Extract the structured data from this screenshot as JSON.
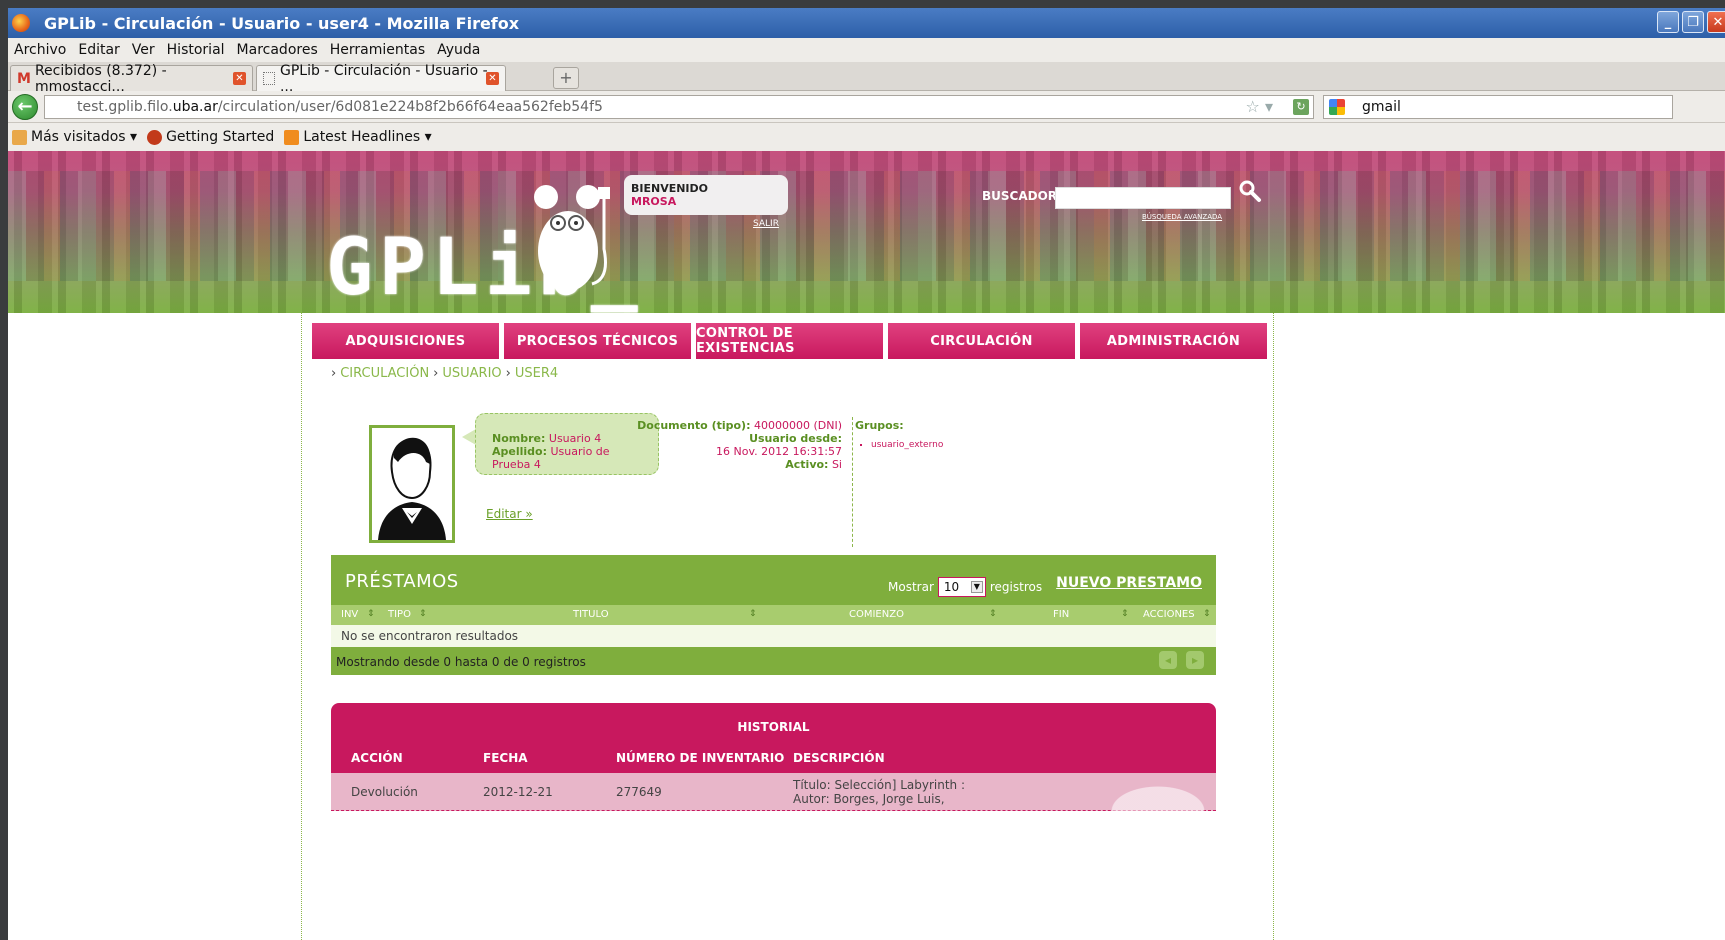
{
  "window": {
    "title": "GPLib - Circulación - Usuario - user4 - Mozilla Firefox"
  },
  "menu": [
    "Archivo",
    "Editar",
    "Ver",
    "Historial",
    "Marcadores",
    "Herramientas",
    "Ayuda"
  ],
  "tabs": [
    {
      "label": "Recibidos (8.372) - mmostacci...",
      "active": false
    },
    {
      "label": "GPLib - Circulación - Usuario - ...",
      "active": true
    }
  ],
  "nav": {
    "url_prefix": "test.gplib.filo.",
    "url_domain": "uba.ar",
    "url_path": "/circulation/user/6d081e224b8f2b66f64eaa562feb54f5",
    "search_value": "gmail"
  },
  "bookmarks": [
    "Más visitados",
    "Getting Started",
    "Latest Headlines"
  ],
  "header": {
    "logo": "GPLib_",
    "welcome_label": "BIENVENIDO",
    "welcome_user": "MROSA",
    "logout": "SALIR",
    "search_label": "BUSCADOR",
    "advanced_search": "BÚSQUEDA AVANZADA"
  },
  "main_nav": [
    "ADQUISICIONES",
    "PROCESOS TÉCNICOS",
    "CONTROL DE EXISTENCIAS",
    "CIRCULACIÓN",
    "ADMINISTRACIÓN"
  ],
  "breadcrumb": [
    "CIRCULACIÓN",
    "USUARIO",
    "USER4"
  ],
  "user": {
    "nombre_label": "Nombre:",
    "nombre": "Usuario 4",
    "apellido_label": "Apellido:",
    "apellido": "Usuario de Prueba 4",
    "edit_link": "Editar »",
    "documento_label": "Documento (tipo):",
    "documento": "40000000 (DNI)",
    "desde_label": "Usuario desde:",
    "desde": "16 Nov. 2012 16:31:57",
    "activo_label": "Activo:",
    "activo": "Si",
    "grupos_label": "Grupos:",
    "grupos": [
      "usuario_externo"
    ]
  },
  "prestamos": {
    "title": "PRÉSTAMOS",
    "mostrar_label": "Mostrar",
    "mostrar_value": "10",
    "registros_label": "registros",
    "new_button": "NUEVO PRESTAMO",
    "columns": [
      "INV",
      "TIPO",
      "TITULO",
      "COMIENZO",
      "FIN",
      "ACCIONES"
    ],
    "empty_message": "No se encontraron resultados",
    "info": "Mostrando desde 0 hasta 0 de 0 registros"
  },
  "historial": {
    "title": "HISTORIAL",
    "columns": [
      "ACCIÓN",
      "FECHA",
      "NÚMERO DE INVENTARIO",
      "DESCRIPCIÓN"
    ],
    "rows": [
      {
        "accion": "Devolución",
        "fecha": "2012-12-21",
        "inventario": "277649",
        "descripcion_1": "Título: Selección] Labyrinth :",
        "descripcion_2": "Autor: Borges, Jorge Luis,"
      }
    ]
  },
  "colors": {
    "pink": "#c8185e",
    "green": "#7fae3d",
    "light_green": "#a8cc6e"
  }
}
